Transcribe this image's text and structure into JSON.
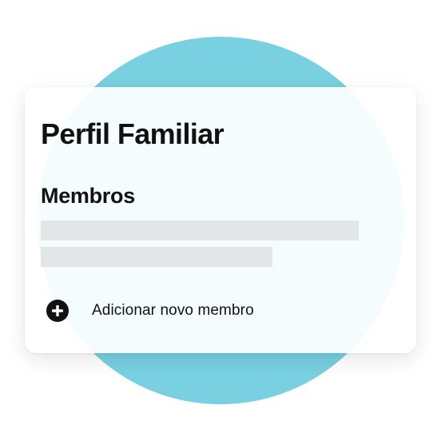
{
  "profile": {
    "title": "Perfil Familiar",
    "members_heading": "Membros",
    "member_placeholders": 2,
    "add_member_label": "Adicionar novo membro",
    "add_icon": "plus-circle-icon"
  },
  "colors": {
    "accent_circle": "#78d0e0",
    "card_background": "#ffffff",
    "placeholder": "#e3e6e7",
    "text": "#111111"
  }
}
